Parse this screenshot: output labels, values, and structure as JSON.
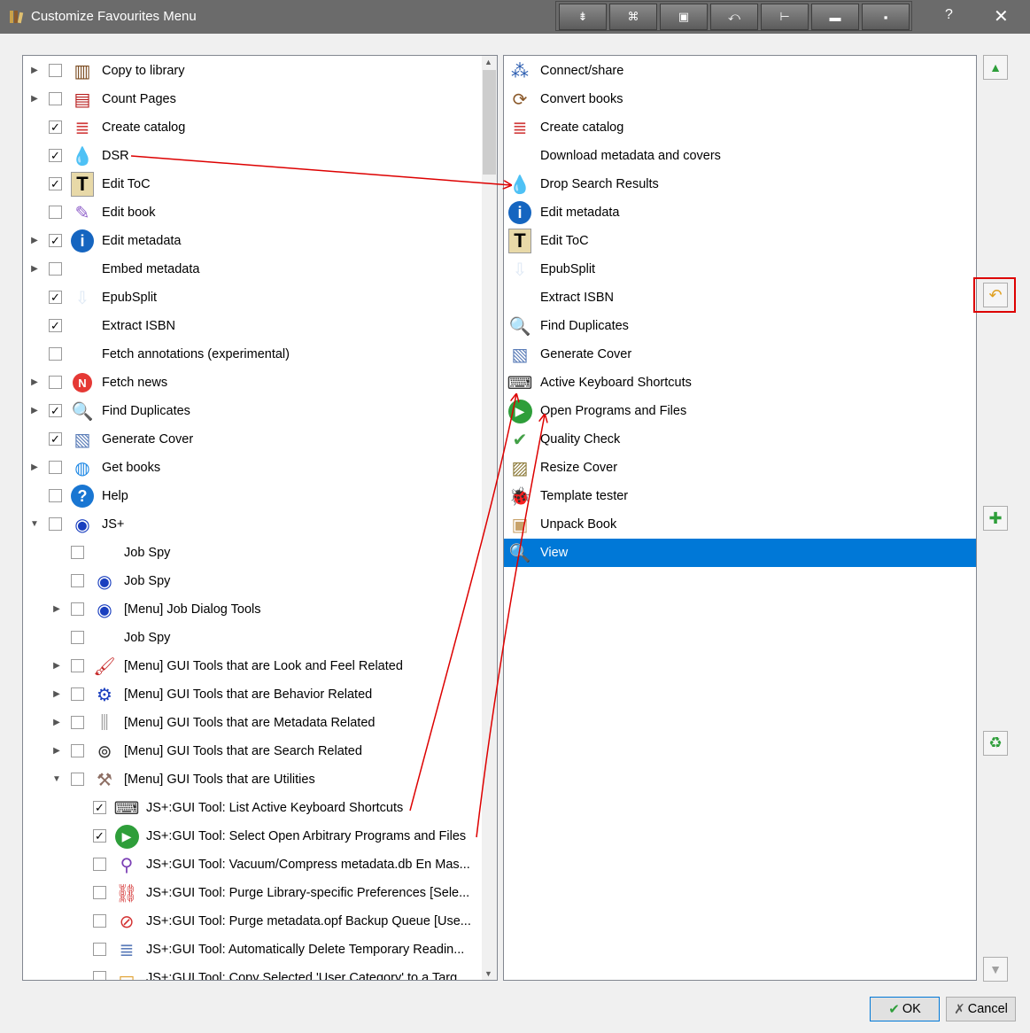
{
  "window": {
    "title": "Customize Favourites Menu",
    "help": "?",
    "close": "✕",
    "toolbar": [
      "⇟",
      "⌘",
      "▣",
      "⤺",
      "⊢",
      "▬",
      "▪"
    ]
  },
  "left_items": [
    {
      "label": "Copy to library",
      "checked": false,
      "expander": "right",
      "icon": "library-icon",
      "color": "#7a4a1e",
      "glyph": "▥"
    },
    {
      "label": "Count Pages",
      "checked": false,
      "expander": "right",
      "icon": "books-icon",
      "color": "#b71c1c",
      "glyph": "▤"
    },
    {
      "label": "Create catalog",
      "checked": true,
      "expander": "",
      "icon": "catalog-stack-icon",
      "color": "#d23c3c",
      "glyph": "≣"
    },
    {
      "label": "DSR",
      "checked": true,
      "expander": "",
      "icon": "water-drop-icon",
      "color": "#1976d2",
      "glyph": "💧"
    },
    {
      "label": "Edit ToC",
      "checked": true,
      "expander": "",
      "icon": "letter-t-icon",
      "color": "#e8d9a8",
      "glyph": "T"
    },
    {
      "label": "Edit book",
      "checked": false,
      "expander": "",
      "icon": "quill-icon",
      "color": "#8e5ec9",
      "glyph": "✎"
    },
    {
      "label": "Edit metadata",
      "checked": true,
      "expander": "right",
      "icon": "info-icon",
      "color": "#1565c0",
      "glyph": "i"
    },
    {
      "label": "Embed metadata",
      "checked": false,
      "expander": "right",
      "icon": "pen-icon",
      "color": "#ffffff",
      "glyph": "✒"
    },
    {
      "label": "EpubSplit",
      "checked": true,
      "expander": "",
      "icon": "split-icon",
      "color": "#dfe9f5",
      "glyph": "⇩"
    },
    {
      "label": "Extract ISBN",
      "checked": true,
      "expander": "",
      "icon": "barcode-icon",
      "color": "#ffffff",
      "glyph": "▮▮"
    },
    {
      "label": "Fetch annotations (experimental)",
      "checked": false,
      "expander": "",
      "icon": "",
      "color": "",
      "glyph": ""
    },
    {
      "label": "Fetch news",
      "checked": false,
      "expander": "right",
      "icon": "news-icon",
      "color": "#e53935",
      "glyph": "N"
    },
    {
      "label": "Find Duplicates",
      "checked": true,
      "expander": "right",
      "icon": "magnifier-icon",
      "color": "#e3edf7",
      "glyph": "🔍"
    },
    {
      "label": "Generate Cover",
      "checked": true,
      "expander": "",
      "icon": "cover-icon",
      "color": "#5b7db8",
      "glyph": "▧"
    },
    {
      "label": "Get books",
      "checked": false,
      "expander": "right",
      "icon": "globe-icon",
      "color": "#1e88e5",
      "glyph": "◍"
    },
    {
      "label": "Help",
      "checked": false,
      "expander": "",
      "icon": "help-icon",
      "color": "#1976d2",
      "glyph": "?"
    },
    {
      "label": "JS+",
      "checked": false,
      "expander": "down",
      "icon": "eye-icon",
      "color": "#1a3fbf",
      "glyph": "◉"
    },
    {
      "label": "Job Spy",
      "checked": false,
      "expander": "",
      "icon": "",
      "color": "",
      "glyph": "",
      "indent": 1
    },
    {
      "label": "Job Spy",
      "checked": false,
      "expander": "",
      "icon": "eye-icon",
      "color": "#1a3fbf",
      "glyph": "◉",
      "indent": 1
    },
    {
      "label": "[Menu] Job Dialog Tools",
      "checked": false,
      "expander": "right",
      "icon": "eye-icon",
      "color": "#1a3fbf",
      "glyph": "◉",
      "indent": 1
    },
    {
      "label": "Job Spy",
      "checked": false,
      "expander": "",
      "icon": "",
      "color": "",
      "glyph": "",
      "indent": 1
    },
    {
      "label": "[Menu] GUI Tools that are Look and Feel Related",
      "checked": false,
      "expander": "right",
      "icon": "paintbrush-icon",
      "color": "#c62828",
      "glyph": "🖌",
      "indent": 1
    },
    {
      "label": "[Menu] GUI Tools that are Behavior Related",
      "checked": false,
      "expander": "right",
      "icon": "gear-icon",
      "color": "#1a3fbf",
      "glyph": "⚙",
      "indent": 1
    },
    {
      "label": "[Menu] GUI Tools that are Metadata Related",
      "checked": false,
      "expander": "right",
      "icon": "column-icon",
      "color": "#9e9e9e",
      "glyph": "⫼",
      "indent": 1
    },
    {
      "label": "[Menu] GUI Tools that are Search Related",
      "checked": false,
      "expander": "right",
      "icon": "binoculars-icon",
      "color": "#333333",
      "glyph": "⊚",
      "indent": 1
    },
    {
      "label": "[Menu] GUI Tools that are Utilities",
      "checked": false,
      "expander": "down",
      "icon": "tools-icon",
      "color": "#8d6e63",
      "glyph": "⚒",
      "indent": 1
    },
    {
      "label": "JS+:GUI Tool:   List Active Keyboard Shortcuts",
      "checked": true,
      "expander": "",
      "icon": "keyboard-icon",
      "color": "#333333",
      "glyph": "⌨",
      "indent": 2
    },
    {
      "label": "JS+:GUI Tool:   Select  Open Arbitrary Programs and Files",
      "checked": true,
      "expander": "",
      "icon": "play-icon",
      "color": "#2e9e3a",
      "glyph": "▶",
      "indent": 2
    },
    {
      "label": "JS+:GUI Tool:   Vacuum/Compress metadata.db En Mas...",
      "checked": false,
      "expander": "",
      "icon": "vacuum-icon",
      "color": "#7b3fb5",
      "glyph": "⚲",
      "indent": 2
    },
    {
      "label": "JS+:GUI Tool:   Purge Library-specific Preferences [Sele...",
      "checked": false,
      "expander": "",
      "icon": "purge-icon",
      "color": "#d32f2f",
      "glyph": "⛓",
      "indent": 2
    },
    {
      "label": "JS+:GUI Tool:   Purge metadata.opf Backup Queue [Use...",
      "checked": false,
      "expander": "",
      "icon": "no-entry-icon",
      "color": "#d32f2f",
      "glyph": "⊘",
      "indent": 2
    },
    {
      "label": "JS+:GUI Tool:   Automatically Delete Temporary Readin...",
      "checked": false,
      "expander": "",
      "icon": "books-stack-icon",
      "color": "#5c7cba",
      "glyph": "≣",
      "indent": 2
    },
    {
      "label": "JS+:GUI Tool:   Copy Selected 'User Category' to a Targ...",
      "checked": false,
      "expander": "",
      "icon": "folder-icon",
      "color": "#e0a030",
      "glyph": "▭",
      "indent": 2
    }
  ],
  "right_items": [
    {
      "label": "Connect/share",
      "icon": "network-icon",
      "color": "#2a5cb0",
      "glyph": "⁂"
    },
    {
      "label": "Convert books",
      "icon": "convert-icon",
      "color": "#8b5a2b",
      "glyph": "⟳"
    },
    {
      "label": "Create catalog",
      "icon": "catalog-stack-icon",
      "color": "#d23c3c",
      "glyph": "≣"
    },
    {
      "label": "Download metadata and covers",
      "icon": "",
      "color": "",
      "glyph": ""
    },
    {
      "label": "Drop Search Results",
      "icon": "water-drop-icon",
      "color": "#1976d2",
      "glyph": "💧"
    },
    {
      "label": "Edit metadata",
      "icon": "info-icon",
      "color": "#1565c0",
      "glyph": "i"
    },
    {
      "label": "Edit ToC",
      "icon": "letter-t-icon",
      "color": "#e8d9a8",
      "glyph": "T"
    },
    {
      "label": "EpubSplit",
      "icon": "split-icon",
      "color": "#dfe9f5",
      "glyph": "⇩"
    },
    {
      "label": "Extract ISBN",
      "icon": "barcode-icon",
      "color": "#ffffff",
      "glyph": "▮▮"
    },
    {
      "label": "Find Duplicates",
      "icon": "magnifier-icon",
      "color": "#e3edf7",
      "glyph": "🔍"
    },
    {
      "label": "Generate Cover",
      "icon": "cover-icon",
      "color": "#5b7db8",
      "glyph": "▧"
    },
    {
      "label": "Active Keyboard Shortcuts",
      "icon": "keyboard-icon",
      "color": "#333333",
      "glyph": "⌨"
    },
    {
      "label": "Open Programs and Files",
      "icon": "play-icon",
      "color": "#2e9e3a",
      "glyph": "▶"
    },
    {
      "label": "Quality Check",
      "icon": "quality-check-icon",
      "color": "#43a047",
      "glyph": "✔"
    },
    {
      "label": "Resize Cover",
      "icon": "resize-icon",
      "color": "#8d7b3a",
      "glyph": "▨"
    },
    {
      "label": "Template tester",
      "icon": "ladybug-icon",
      "color": "#c62828",
      "glyph": "🐞"
    },
    {
      "label": "Unpack Book",
      "icon": "box-icon",
      "color": "#c8a26a",
      "glyph": "▣"
    },
    {
      "label": "View",
      "icon": "view-icon",
      "color": "#1e4f9a",
      "glyph": "🔍",
      "selected": true
    }
  ],
  "side_buttons": {
    "up": "▲",
    "reset": "↶",
    "add": "✚",
    "remove": "♻",
    "down": "▼"
  },
  "buttons": {
    "ok": "OK",
    "cancel": "Cancel"
  },
  "colors": {
    "selection": "#0078d7",
    "annotation": "#dd0000"
  }
}
